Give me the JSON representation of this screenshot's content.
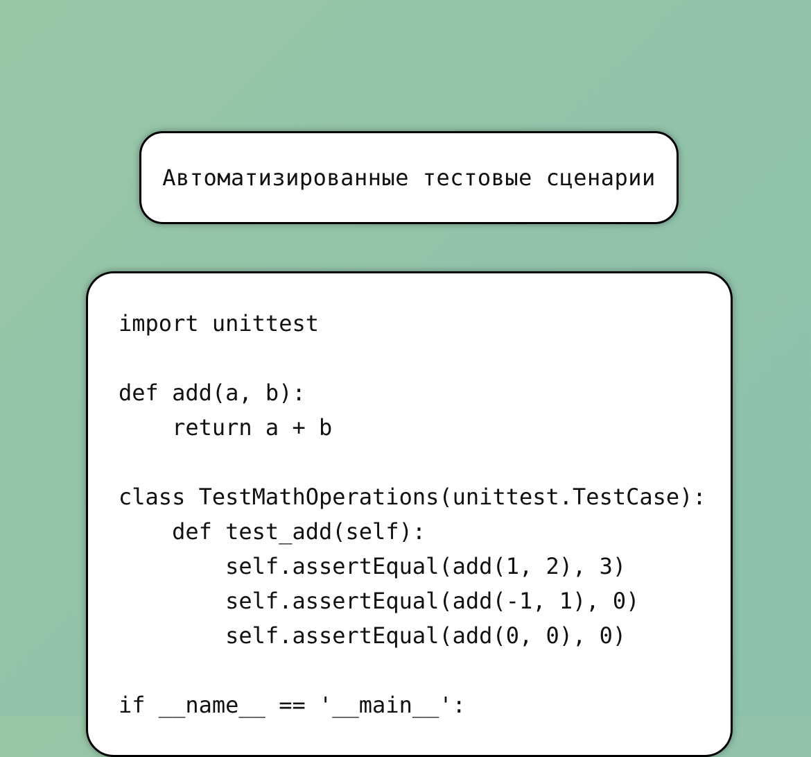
{
  "title": "Автоматизированные тестовые сценарии",
  "code_lines": [
    "import unittest",
    "",
    "def add(a, b):",
    "    return a + b",
    "",
    "class TestMathOperations(unittest.TestCase):",
    "    def test_add(self):",
    "        self.assertEqual(add(1, 2), 3)",
    "        self.assertEqual(add(-1, 1), 0)",
    "        self.assertEqual(add(0, 0), 0)",
    "",
    "if __name__ == '__main__':"
  ]
}
